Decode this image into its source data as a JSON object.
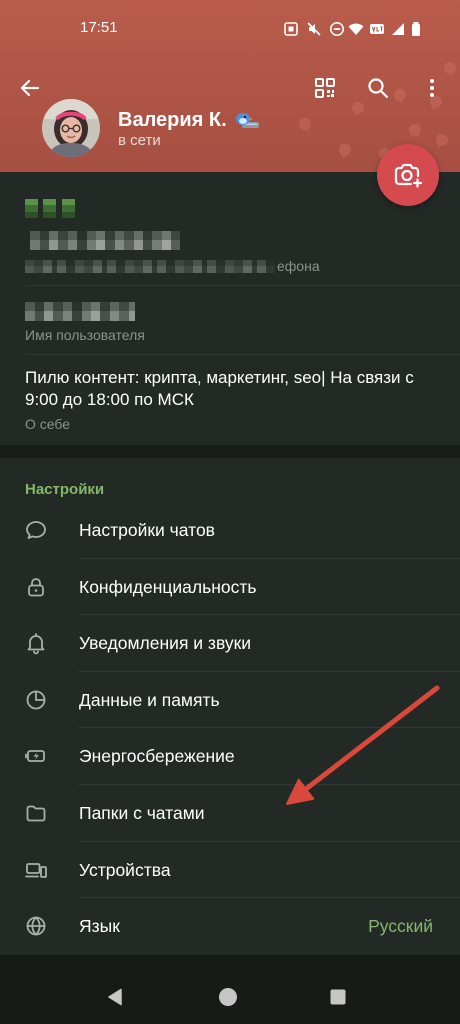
{
  "status_bar": {
    "time": "17:51",
    "icons": [
      "screenshot-notification-icon",
      "mute-icon",
      "do-not-disturb-icon",
      "wifi-icon",
      "volte-icon",
      "cellular-signal-icon",
      "battery-icon"
    ]
  },
  "header": {
    "name": "Валерия К.",
    "status": "в сети",
    "icons": [
      "back-arrow-icon",
      "qr-code-icon",
      "search-icon",
      "more-vertical-icon",
      "emoji-status-icon",
      "camera-add-icon"
    ]
  },
  "profile": {
    "phone_label_fragment": "ефона",
    "username_label": "Имя пользователя",
    "bio": "Пилю контент: крипта, маркетинг, seo| На связи с 9:00 до 18:00 по МСК",
    "bio_label": "О себе"
  },
  "settings": {
    "section_title": "Настройки",
    "items": [
      {
        "label": "Настройки чатов",
        "icon": "chat-bubble-icon"
      },
      {
        "label": "Конфиденциальность",
        "icon": "lock-icon"
      },
      {
        "label": "Уведомления и звуки",
        "icon": "bell-icon"
      },
      {
        "label": "Данные и память",
        "icon": "pie-chart-icon"
      },
      {
        "label": "Энергосбережение",
        "icon": "battery-saver-icon"
      },
      {
        "label": "Папки с чатами",
        "icon": "folder-icon"
      },
      {
        "label": "Устройства",
        "icon": "devices-icon"
      },
      {
        "label": "Язык",
        "icon": "globe-icon",
        "value": "Русский"
      }
    ]
  },
  "nav_bar": {
    "icons": [
      "nav-back-icon",
      "nav-home-icon",
      "nav-recents-icon"
    ]
  },
  "colors": {
    "header_top": "#b95c4b",
    "header_bottom": "#a64f42",
    "background": "#232a25",
    "section_gap": "#181d19",
    "accent_green": "#84b76b",
    "fab": "#d44a4f",
    "text_secondary": "#8b928d",
    "icon_gray": "#a9afab",
    "annotation_arrow": "#d9493b"
  }
}
